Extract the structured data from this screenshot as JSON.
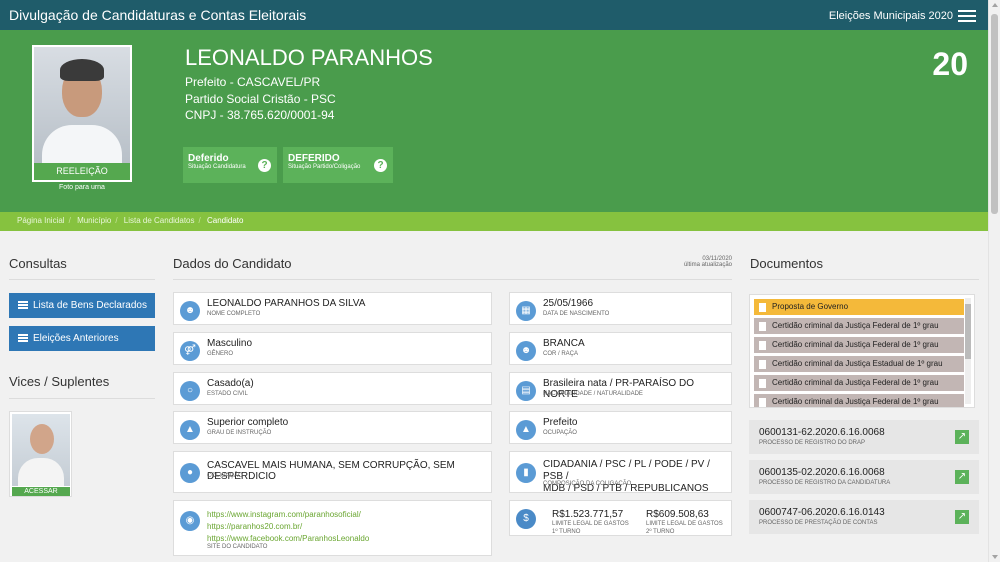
{
  "header": {
    "title": "Divulgação de Candidaturas e Contas Eleitorais",
    "election": "Eleições Municipais 2020",
    "menu_icon": "hamburger-menu-icon"
  },
  "candidate": {
    "photo_label": "REELEIÇÃO",
    "photo_caption": "Foto para urna",
    "name": "LEONALDO PARANHOS",
    "office": "Prefeito - CASCAVEL/PR",
    "party": "Partido Social Cristão - PSC",
    "cnpj": "CNPJ - 38.765.620/0001-94",
    "number": "20",
    "status_candidacy": {
      "title": "Deferido",
      "sub": "Situação Candidatura"
    },
    "status_party": {
      "title": "DEFERIDO",
      "sub": "Situação Partido/Coligação"
    }
  },
  "breadcrumb": [
    "Página Inicial",
    "Município",
    "Lista de Candidatos",
    "Candidato"
  ],
  "sidebar": {
    "consultas_title": "Consultas",
    "buttons": [
      "Lista de Bens Declarados",
      "Eleições Anteriores"
    ],
    "vices_title": "Vices / Suplentes",
    "vice_button": "ACESSAR"
  },
  "dados": {
    "title": "Dados do Candidato",
    "updated_date": "03/11/2020",
    "updated_label": "última atualização",
    "left": [
      {
        "value": "LEONALDO PARANHOS DA SILVA",
        "label": "NOME COMPLETO",
        "icon": "user-icon"
      },
      {
        "value": "Masculino",
        "label": "GÊNERO",
        "icon": "gender-icon"
      },
      {
        "value": "Casado(a)",
        "label": "ESTADO CIVIL",
        "icon": "ring-icon"
      },
      {
        "value": "Superior completo",
        "label": "GRAU DE INSTRUÇÃO",
        "icon": "graduation-cap-icon"
      },
      {
        "value": "CASCAVEL MAIS HUMANA, SEM CORRUPÇÃO, SEM DESPERDICIO",
        "label": "COLIGAÇÃO",
        "icon": "group-icon"
      }
    ],
    "right": [
      {
        "value": "25/05/1966",
        "label": "DATA DE NASCIMENTO",
        "icon": "calendar-icon"
      },
      {
        "value": "BRANCA",
        "label": "COR / RAÇA",
        "icon": "person-icon"
      },
      {
        "value": "Brasileira nata / PR-PARAÍSO DO NORTE",
        "label": "NACIONALIDADE / NATURALIDADE",
        "icon": "map-icon"
      },
      {
        "value": "Prefeito",
        "label": "OCUPAÇÃO",
        "icon": "bank-icon"
      },
      {
        "value_line1": "CIDADANIA / PSC / PL / PODE / PV / PSB /",
        "value_line2": "MDB / PSD / PTB / REPUBLICANOS",
        "label": "COMPOSIÇÃO DA COLIGAÇÃO",
        "icon": "folder-icon"
      }
    ],
    "site": {
      "links": [
        "https://www.instagram.com/paranhosoficial/",
        "https://paranhos20.com.br/",
        "https://www.facebook.com/ParanhosLeonaldo"
      ],
      "label": "SITE DO CANDIDATO",
      "icon": "globe-icon"
    },
    "spending": {
      "icon": "dollar-icon",
      "first_value": "R$1.523.771,57",
      "first_label1": "LIMITE LEGAL DE GASTOS",
      "first_label2": "1º TURNO",
      "second_value": "R$609.508,63",
      "second_label1": "LIMITE LEGAL DE GASTOS",
      "second_label2": "2º TURNO"
    }
  },
  "documents": {
    "title": "Documentos",
    "items": [
      "Proposta de Governo",
      "Certidão criminal da Justiça Federal de 1º grau",
      "Certidão criminal da Justiça Federal de 1º grau",
      "Certidão criminal da Justiça Estadual de 1º grau",
      "Certidão criminal da Justiça Federal de 1º grau",
      "Certidão criminal da Justiça Federal de 1º grau"
    ],
    "processes": [
      {
        "value": "0600131-62.2020.6.16.0068",
        "label": "PROCESSO DE REGISTRO DO DRAP"
      },
      {
        "value": "0600135-02.2020.6.16.0068",
        "label": "PROCESSO DE REGISTRO DA CANDIDATURA"
      },
      {
        "value": "0600747-06.2020.6.16.0143",
        "label": "PROCESSO DE PRESTAÇÃO DE CONTAS"
      }
    ]
  },
  "colors": {
    "topbar": "#1f5c6a",
    "hero": "#4a9c4c",
    "breadcrumb": "#86c23f",
    "button": "#2e77b5",
    "highlight_doc": "#f4b93a"
  }
}
